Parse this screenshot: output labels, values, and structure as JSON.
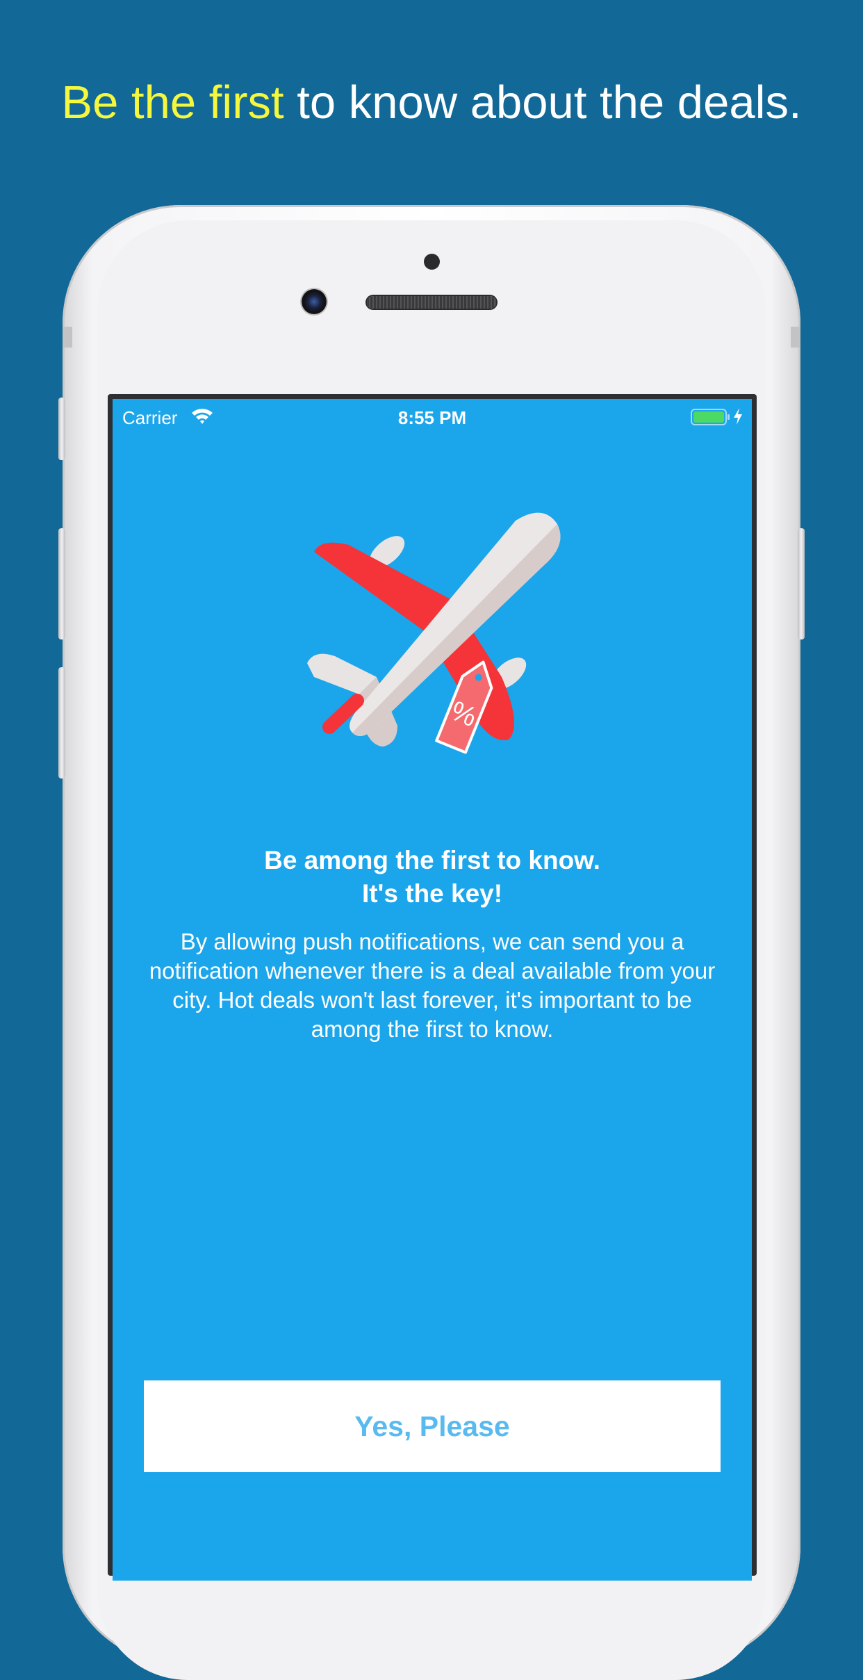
{
  "headline": {
    "highlight": "Be the first",
    "rest": " to know about the deals."
  },
  "status_bar": {
    "carrier": "Carrier",
    "time": "8:55 PM",
    "battery_icon": "battery-charging-icon",
    "wifi_icon": "wifi-icon"
  },
  "onboarding": {
    "illustration": "airplane-discount-tag-icon",
    "tag_symbol": "%",
    "title_line1": "Be among the first to know.",
    "title_line2": "It's the key!",
    "description": "By allowing push notifications, we can send you a notification whenever there is a deal available from your city. Hot deals won't last forever, it's important to be among the first to know.",
    "cta_label": "Yes, Please"
  },
  "colors": {
    "page_background": "#126896",
    "headline_highlight": "#f4f73d",
    "screen_background": "#1ba5eb",
    "button_text": "#59baf0",
    "plane_wing": "#f43439",
    "tag": "#f56a6e"
  }
}
